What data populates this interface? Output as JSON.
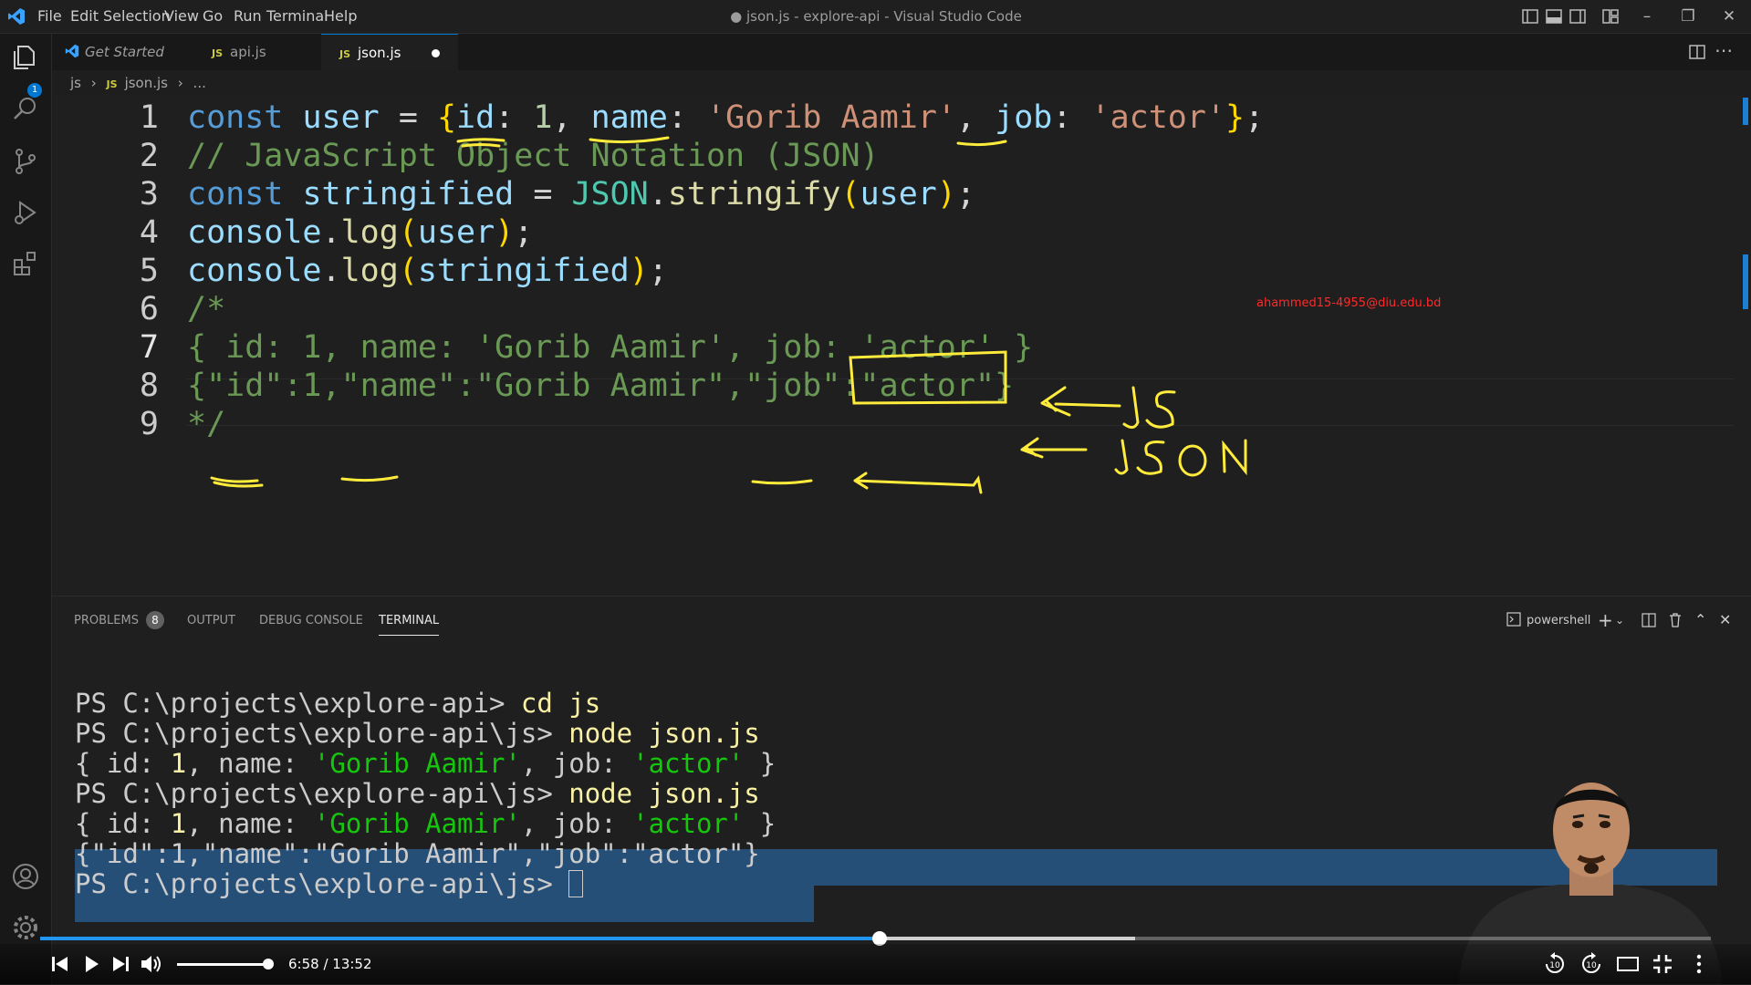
{
  "window": {
    "title": "● json.js - explore-api - Visual Studio Code",
    "menu": [
      "File",
      "Edit",
      "Selection",
      "View",
      "Go",
      "Run",
      "Terminal",
      "Help"
    ]
  },
  "activity_bar": {
    "icons": [
      "explorer-icon",
      "search-icon",
      "source-control-icon",
      "run-debug-icon",
      "extensions-icon",
      "account-icon",
      "manage-gear-icon"
    ],
    "explorer_badge": "1"
  },
  "tabs": [
    {
      "label": "Get Started",
      "icon": "vscode-logo-icon"
    },
    {
      "label": "api.js",
      "icon": "JS"
    },
    {
      "label": "json.js",
      "icon": "JS",
      "active": true,
      "dirty": true
    }
  ],
  "breadcrumb": {
    "folder": "js",
    "file": "json.js",
    "icon": "JS",
    "more": "..."
  },
  "editor": {
    "line_numbers": [
      "1",
      "2",
      "3",
      "4",
      "5",
      "6",
      "7",
      "8",
      "9"
    ],
    "lines": [
      "const user = {id: 1, name: 'Gorib Aamir', job: 'actor'};",
      "// JavaScript Object Notation (JSON)",
      "const stringified = JSON.stringify(user);",
      "console.log(user);",
      "console.log(stringified);",
      "/*",
      "{ id: 1, name: 'Gorib Aamir', job: 'actor' }",
      "{\"id\":1,\"name\":\"Gorib Aamir\",\"job\":\"actor\"}",
      "*/"
    ],
    "watermark_email": "ahammed15-4955@diu.edu.bd",
    "annotations": {
      "js_label": "JS",
      "json_label": "JSON",
      "color": "#ffeb3b"
    }
  },
  "panel": {
    "tabs": [
      "PROBLEMS",
      "OUTPUT",
      "DEBUG CONSOLE",
      "TERMINAL"
    ],
    "problems_count": "8",
    "active_tab": "TERMINAL",
    "shell": "powershell",
    "terminal_lines": [
      {
        "prompt": "PS C:\\projects\\explore-api> ",
        "cmd": "cd js"
      },
      {
        "prompt": "PS C:\\projects\\explore-api\\js> ",
        "cmd": "node json.js"
      },
      {
        "output": "{ id: 1, name: 'Gorib Aamir', job: 'actor' }"
      },
      {
        "prompt": "PS C:\\projects\\explore-api\\js> ",
        "cmd": "node json.js"
      },
      {
        "output": "{ id: 1, name: 'Gorib Aamir', job: 'actor' }",
        "selected": true
      },
      {
        "output": "{\"id\":1,\"name\":\"Gorib Aamir\",\"job\":\"actor\"}",
        "selected": true
      },
      {
        "prompt": "PS C:\\projects\\explore-api\\js> ",
        "cmd": ""
      }
    ]
  },
  "video": {
    "time": "6:58 / 13:52",
    "progress": 0.503,
    "buffered": 0.655,
    "volume": 0.9,
    "accent": "#2196f3",
    "controls": [
      "previous-icon",
      "play-icon",
      "next-icon",
      "volume-icon",
      "rewind-10-icon",
      "forward-10-icon",
      "theater-mode-icon",
      "exit-fullscreen-icon",
      "more-options-icon"
    ]
  }
}
